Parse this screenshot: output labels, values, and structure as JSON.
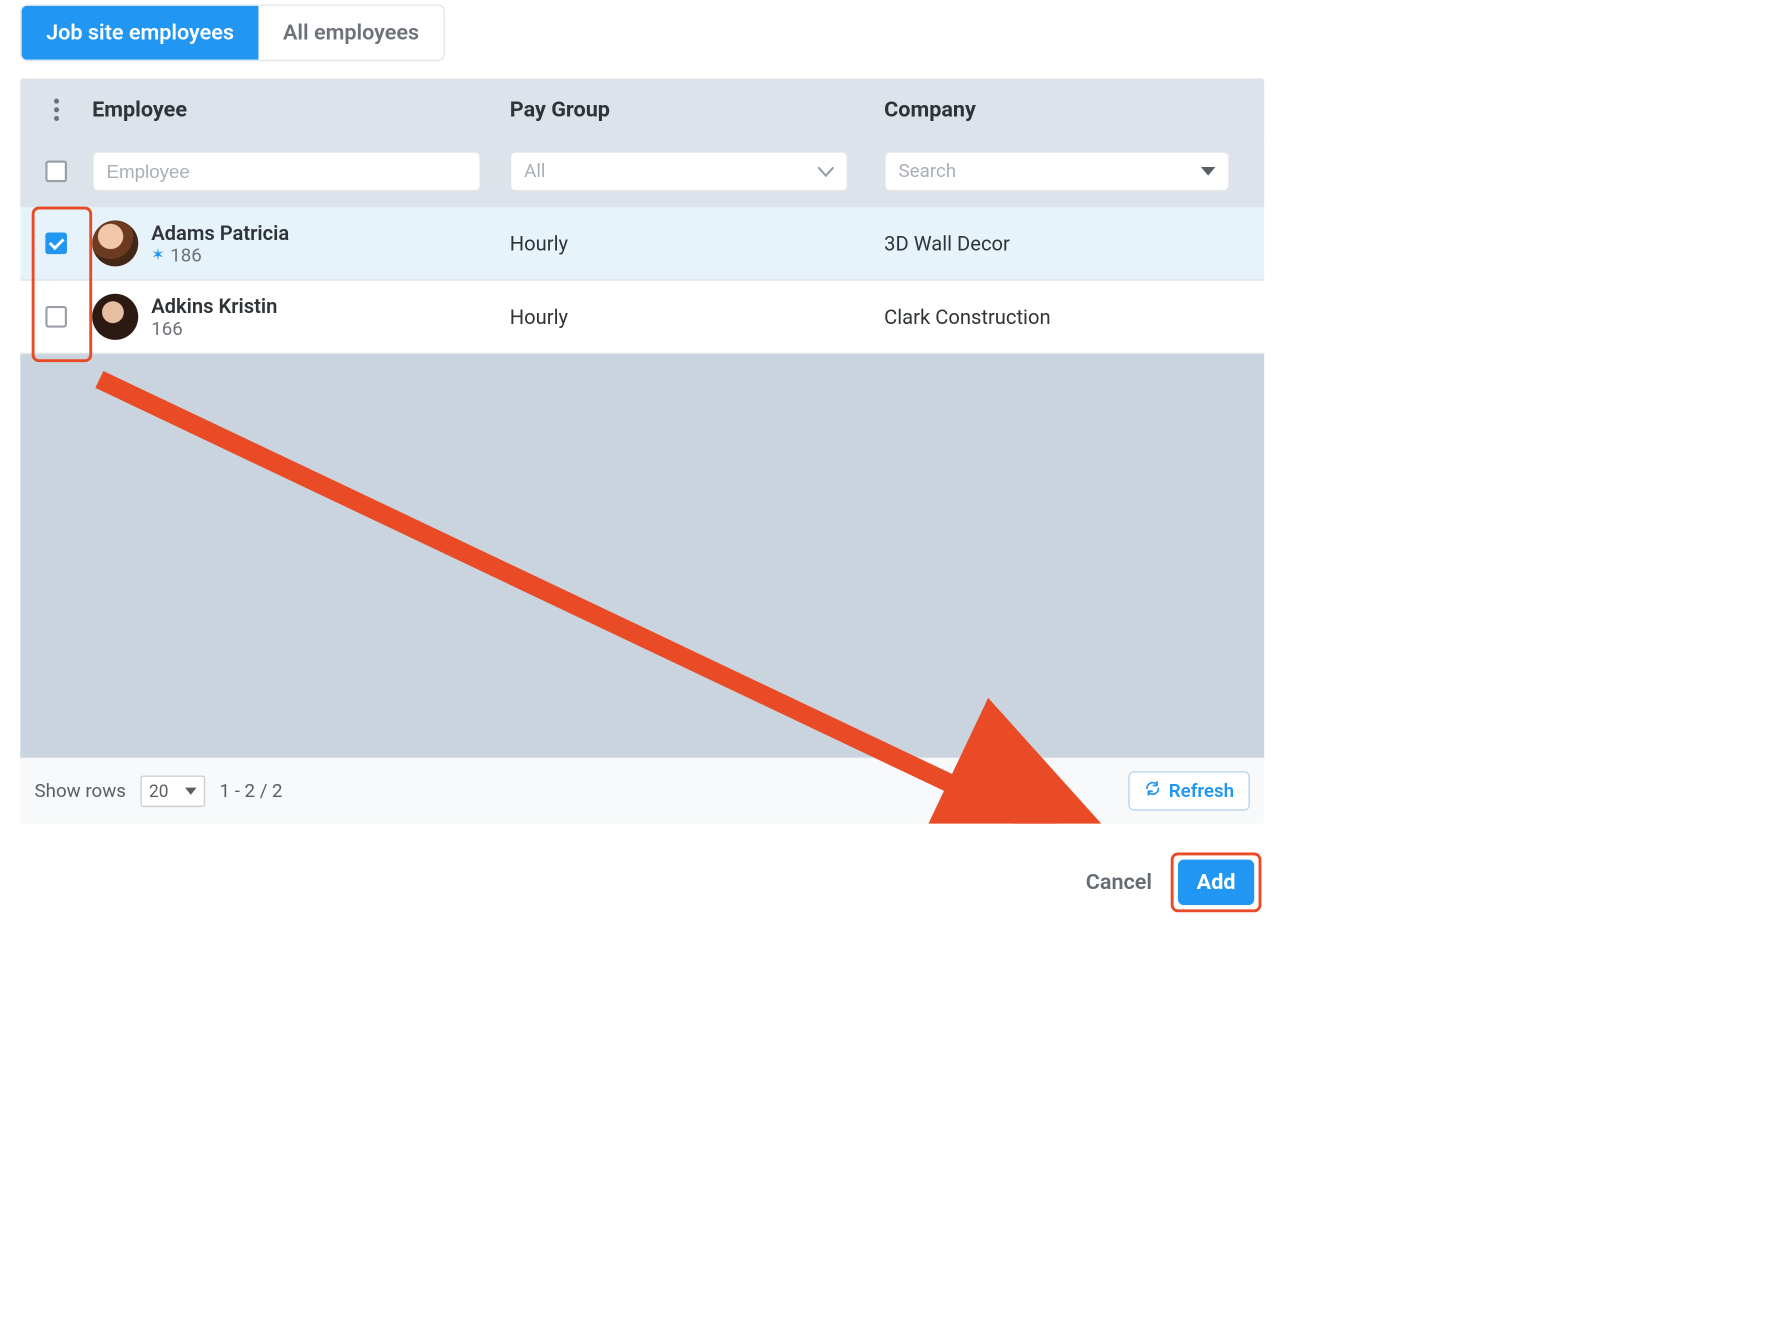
{
  "tabs": {
    "job_site": "Job site employees",
    "all": "All employees"
  },
  "columns": {
    "employee": "Employee",
    "pay_group": "Pay Group",
    "company": "Company"
  },
  "filters": {
    "employee_placeholder": "Employee",
    "pay_group_value": "All",
    "company_value": "Search"
  },
  "rows": [
    {
      "name": "Adams Patricia",
      "id": "186",
      "star": true,
      "pay_group": "Hourly",
      "company": "3D Wall Decor",
      "checked": true
    },
    {
      "name": "Adkins Kristin",
      "id": "166",
      "star": false,
      "pay_group": "Hourly",
      "company": "Clark Construction",
      "checked": false
    }
  ],
  "footer": {
    "show_rows_label": "Show rows",
    "rows_per_page": "20",
    "range": "1 - 2 / 2",
    "refresh": "Refresh"
  },
  "actions": {
    "cancel": "Cancel",
    "add": "Add"
  },
  "colors": {
    "accent": "#2196f3",
    "highlight": "#e94b27"
  }
}
